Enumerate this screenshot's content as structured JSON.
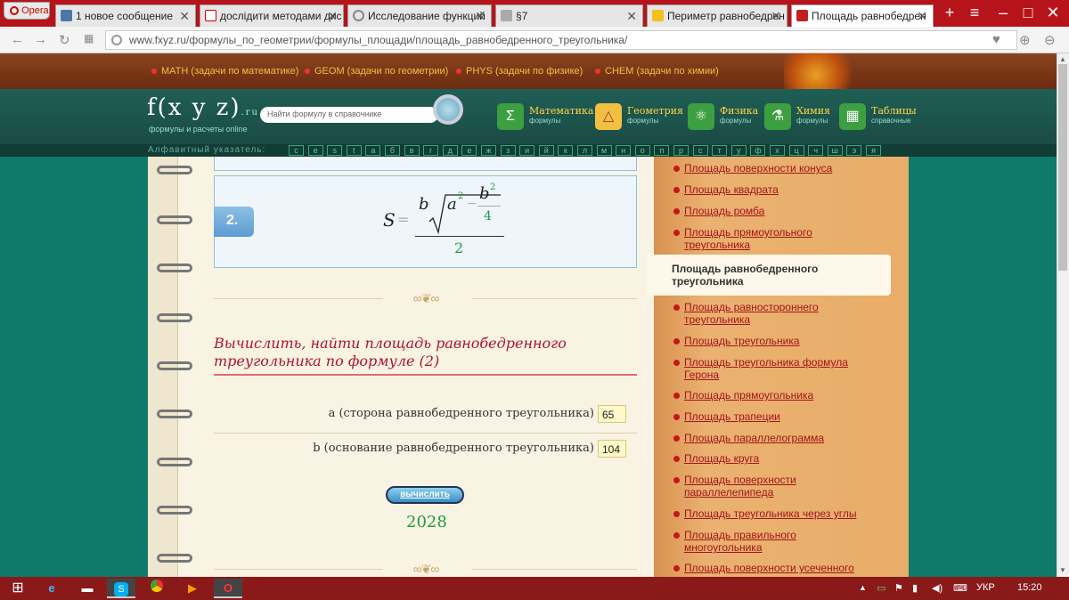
{
  "browser": {
    "opera_label": "Opera",
    "tabs": [
      {
        "label": "1 новое сообщение",
        "icon": "vk-icon"
      },
      {
        "label": "дослідити методами дис",
        "icon": "yandex-icon"
      },
      {
        "label": "Исследование функций",
        "icon": "loading-icon"
      },
      {
        "label": "§7",
        "icon": "document-icon"
      },
      {
        "label": "Периметр равнобедрен",
        "icon": "bookmark-icon"
      },
      {
        "label": "Площадь равнобедрен",
        "icon": "site-icon"
      }
    ],
    "url": "www.fxyz.ru/формулы_по_геометрии/формулы_площади/площадь_равнобедренного_треугольника/"
  },
  "topnav": [
    "MATH (задачи по математике)",
    "GEOM (задачи по геометрии)",
    "PHYS (задачи по физике)",
    "CHEM (задачи по химии)"
  ],
  "header": {
    "logo": "f(x y z)",
    "logo_suffix": ".ru",
    "logo_sub": "формулы и расчеты online",
    "search_placeholder": "Найти формулу в справочнике",
    "categories": [
      {
        "name": "Математика",
        "sub": "формулы",
        "icon": "Σ"
      },
      {
        "name": "Геометрия",
        "sub": "формулы",
        "icon": "△"
      },
      {
        "name": "Физика",
        "sub": "формулы",
        "icon": "⚛"
      },
      {
        "name": "Химия",
        "sub": "формулы",
        "icon": "⚗"
      },
      {
        "name": "Таблицы",
        "sub": "справочные",
        "icon": "▦"
      }
    ]
  },
  "alphabet": {
    "label": "Алфавитный указатель:",
    "letters": [
      "c",
      "e",
      "s",
      "t",
      "а",
      "б",
      "в",
      "г",
      "д",
      "е",
      "ж",
      "з",
      "и",
      "й",
      "к",
      "л",
      "м",
      "н",
      "о",
      "п",
      "р",
      "с",
      "т",
      "у",
      "ф",
      "х",
      "ц",
      "ч",
      "ш",
      "э",
      "я"
    ]
  },
  "formula": {
    "number": "2.",
    "lhs": "S",
    "eq": "=",
    "b": "b",
    "a": "a",
    "sup2": "2",
    "minus": "−",
    "four": "4",
    "denominator": "2"
  },
  "calculator": {
    "title": "Вычислить, найти площадь равнобедренного треугольника по формуле (2)",
    "fields": [
      {
        "label": "a (сторона равнобедренного треугольника)",
        "value": "65"
      },
      {
        "label": "b (основание равнобедренного треугольника)",
        "value": "104"
      }
    ],
    "button": "вычислить",
    "result": "2028"
  },
  "sidebar": {
    "items": [
      "Площадь поверхности конуса",
      "Площадь квадрата",
      "Площадь ромба",
      "Площадь прямоугольного треугольника",
      "Площадь равностороннего треугольника",
      "Площадь треугольника",
      "Площадь треугольника формула Герона",
      "Площадь прямоугольника",
      "Площадь трапеции",
      "Площадь параллелограмма",
      "Площадь круга",
      "Площадь поверхности параллелепипеда",
      "Площадь треугольника через углы",
      "Площадь правильного многоугольника",
      "Площадь поверхности усеченного"
    ],
    "active": "Площадь равнобедренного треугольника"
  },
  "taskbar": {
    "lang": "УКР",
    "time": "15:20"
  }
}
